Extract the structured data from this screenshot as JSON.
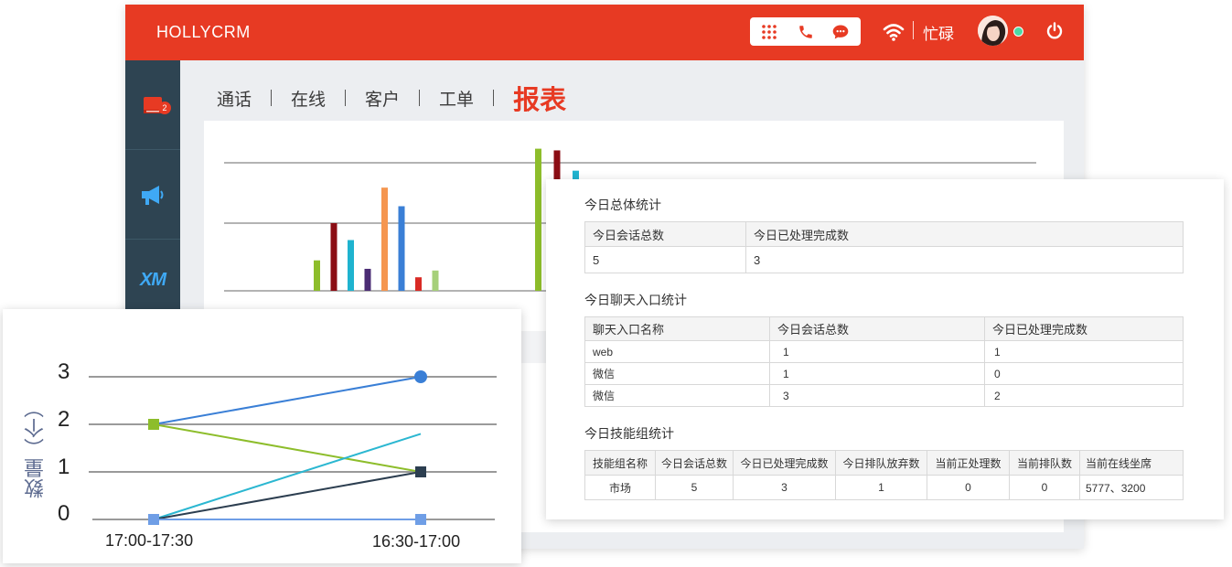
{
  "header": {
    "brand": "HOLLYCRM",
    "status": "忙碌",
    "icons": [
      "dialpad-icon",
      "phone-icon",
      "chat-icon",
      "wifi-icon",
      "avatar",
      "power-icon"
    ]
  },
  "sidebar": {
    "items": [
      {
        "icon": "book-icon",
        "badge": "2"
      },
      {
        "icon": "megaphone-icon"
      },
      {
        "icon": "xm-logo-icon",
        "label": "XM"
      }
    ]
  },
  "tabs": [
    {
      "label": "通话",
      "active": false
    },
    {
      "label": "在线",
      "active": false
    },
    {
      "label": "客户",
      "active": false
    },
    {
      "label": "工单",
      "active": false
    },
    {
      "label": "报表",
      "active": true
    }
  ],
  "stats": {
    "overall": {
      "title": "今日总体统计",
      "headers": [
        "今日会话总数",
        "今日已处理完成数"
      ],
      "rows": [
        [
          "5",
          "3"
        ]
      ]
    },
    "chat_entry": {
      "title": "今日聊天入口统计",
      "headers": [
        "聊天入口名称",
        "今日会话总数",
        "今日已处理完成数"
      ],
      "rows": [
        [
          "web",
          "1",
          "1"
        ],
        [
          "微信",
          "1",
          "0"
        ],
        [
          "微信",
          "3",
          "2"
        ]
      ]
    },
    "skill_group": {
      "title": "今日技能组统计",
      "headers": [
        "技能组名称",
        "今日会话总数",
        "今日已处理完成数",
        "今日排队放弃数",
        "当前正处理数",
        "当前排队数",
        "当前在线坐席"
      ],
      "rows": [
        [
          "市场",
          "5",
          "3",
          "1",
          "0",
          "0",
          "5777、3200"
        ]
      ]
    }
  },
  "chart_data": [
    {
      "type": "bar",
      "grid": true,
      "groups": [
        {
          "values": [
            0.18,
            0.4,
            0.3,
            0.13,
            0.61,
            0.5,
            0.08,
            0.12
          ],
          "colors": [
            "#8dbd2b",
            "#8b0d14",
            "#1fb3cf",
            "#4b2c74",
            "#f59650",
            "#3a7fd6",
            "#d92a25",
            "#a6d07a"
          ]
        },
        {
          "values": [
            0.84,
            0.83,
            0.71
          ],
          "colors": [
            "#8dbd2b",
            "#8b0d14",
            "#1fb3cf"
          ]
        }
      ]
    },
    {
      "type": "line",
      "ylabel": "数量（个）",
      "categories": [
        "17:00-17:30",
        "16:30-17:00"
      ],
      "y_ticks": [
        "0",
        "1",
        "2",
        "3"
      ],
      "ylim": [
        0,
        3
      ],
      "grid": true,
      "series": [
        {
          "values": [
            2,
            3
          ],
          "color": "#3a7fd6",
          "marker": "circle"
        },
        {
          "values": [
            2,
            1
          ],
          "color": "#8dbd2b",
          "marker": "square"
        },
        {
          "values": [
            0,
            1.8
          ],
          "color": "#2bb7d1",
          "marker": "none"
        },
        {
          "values": [
            0,
            1
          ],
          "color": "#2c3e50",
          "marker": "square"
        },
        {
          "values": [
            0,
            0
          ],
          "color": "#6f9ee6",
          "marker": "square"
        }
      ]
    }
  ]
}
